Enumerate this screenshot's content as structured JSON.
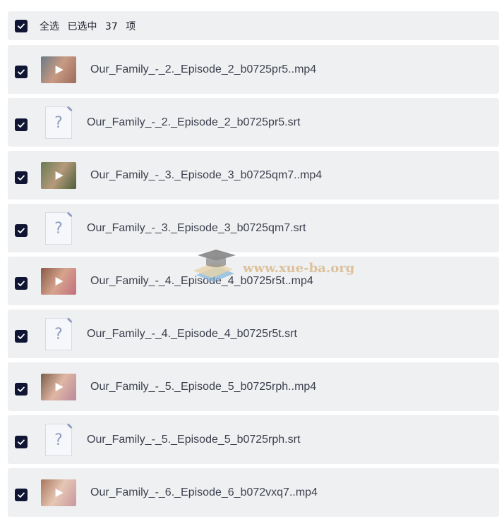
{
  "header": {
    "select_all_label": "全选",
    "selected_label": "已选中",
    "selected_count": "37",
    "unit_label": "项"
  },
  "files": [
    {
      "name": "Our_Family_-_2._Episode_2_b0725pr5..mp4",
      "type": "video",
      "thumb_colors": [
        "#6b7a86",
        "#c89a82",
        "#9b6c5c"
      ]
    },
    {
      "name": "Our_Family_-_2._Episode_2_b0725pr5.srt",
      "type": "unknown"
    },
    {
      "name": "Our_Family_-_3._Episode_3_b0725qm7..mp4",
      "type": "video",
      "thumb_colors": [
        "#6a7b55",
        "#b59a7a",
        "#4d5f3a"
      ]
    },
    {
      "name": "Our_Family_-_3._Episode_3_b0725qm7.srt",
      "type": "unknown"
    },
    {
      "name": "Our_Family_-_4._Episode_4_b0725r5t..mp4",
      "type": "video",
      "thumb_colors": [
        "#8a5a45",
        "#d6a48d",
        "#c26f7d"
      ]
    },
    {
      "name": "Our_Family_-_4._Episode_4_b0725r5t.srt",
      "type": "unknown"
    },
    {
      "name": "Our_Family_-_5._Episode_5_b0725rph..mp4",
      "type": "video",
      "thumb_colors": [
        "#7c5d4c",
        "#e0b7a4",
        "#b9889c"
      ]
    },
    {
      "name": "Our_Family_-_5._Episode_5_b0725rph.srt",
      "type": "unknown"
    },
    {
      "name": "Our_Family_-_6._Episode_6_b072vxq7..mp4",
      "type": "video",
      "thumb_colors": [
        "#a9765e",
        "#e6c7b4",
        "#c9969f"
      ]
    }
  ],
  "watermark": {
    "text": "www.xue-ba.org"
  },
  "colors": {
    "checkbox": "#0f1533",
    "row_bg": "#eff0f2"
  }
}
